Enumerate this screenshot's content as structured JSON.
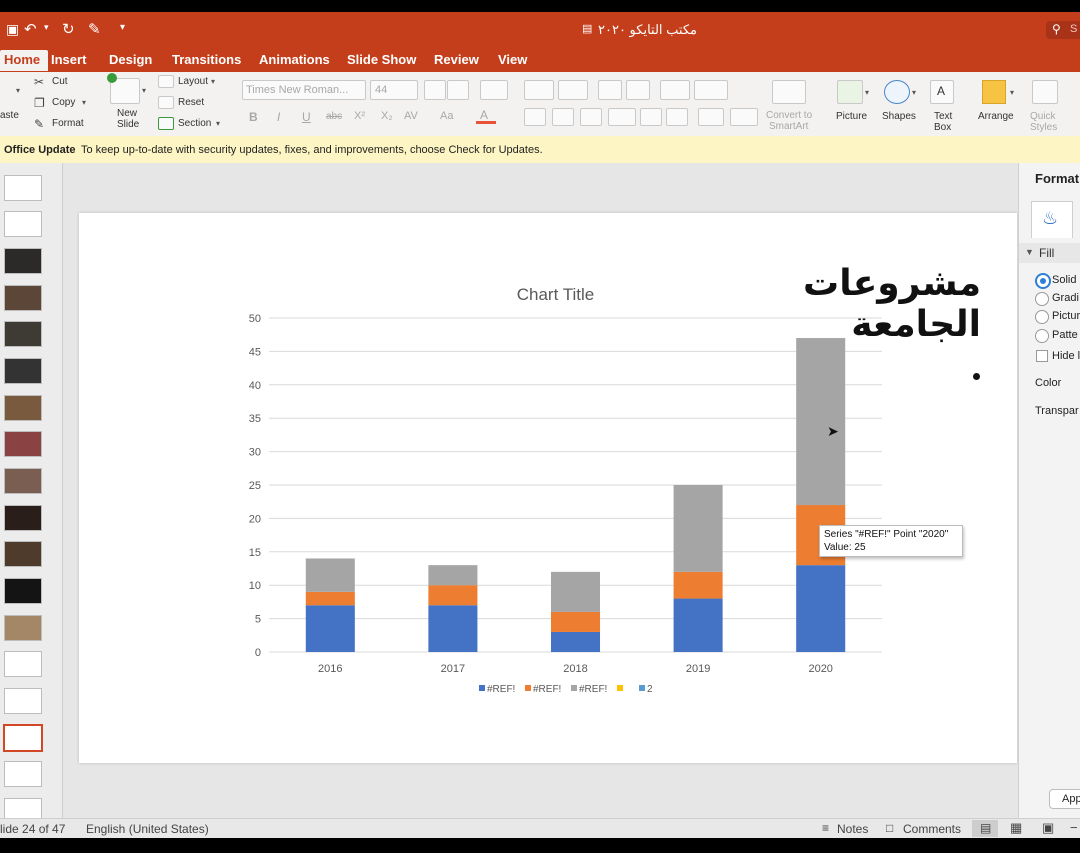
{
  "window": {
    "title": "مكتب التايكو ٢٠٢٠",
    "search_placeholder": "S"
  },
  "tabs": [
    "Home",
    "Insert",
    "Design",
    "Transitions",
    "Animations",
    "Slide Show",
    "Review",
    "View"
  ],
  "ribbon": {
    "paste": "aste",
    "cut": "Cut",
    "copy": "Copy",
    "format": "Format",
    "new_slide_line1": "New",
    "new_slide_line2": "Slide",
    "layout": "Layout",
    "reset": "Reset",
    "section": "Section",
    "font_name": "Times New Roman...",
    "font_size": "44",
    "convert_line1": "Convert to",
    "convert_line2": "SmartArt",
    "picture": "Picture",
    "shapes": "Shapes",
    "textbox_line1": "Text",
    "textbox_line2": "Box",
    "arrange": "Arrange",
    "quick_line1": "Quick",
    "quick_line2": "Styles"
  },
  "update_bar": {
    "label": "Office Update",
    "message": "To keep up-to-date with security updates, fixes, and improvements, choose Check for Updates."
  },
  "slide": {
    "heading": "مشروعات الجامعة"
  },
  "chart_data": {
    "type": "bar",
    "stacked": true,
    "title": "Chart Title",
    "categories": [
      "2016",
      "2017",
      "2018",
      "2019",
      "2020"
    ],
    "series": [
      {
        "name": "#REF!",
        "color": "#4472c4",
        "values": [
          7,
          7,
          3,
          8,
          13
        ]
      },
      {
        "name": "#REF!",
        "color": "#ed7d31",
        "values": [
          2,
          3,
          3,
          4,
          9
        ]
      },
      {
        "name": "#REF!",
        "color": "#a5a5a5",
        "values": [
          5,
          3,
          6,
          13,
          25
        ]
      }
    ],
    "extra_legend": [
      {
        "name": "",
        "color": "#ffc000"
      },
      {
        "name": "2",
        "color": "#5b9bd5"
      }
    ],
    "ylim": [
      0,
      50
    ],
    "yticks": [
      0,
      5,
      10,
      15,
      20,
      25,
      30,
      35,
      40,
      45,
      50
    ],
    "grid": true,
    "legend": "bottom"
  },
  "tooltip": {
    "line1": "Series \"#REF!\" Point \"2020\"",
    "line2": "Value: 25"
  },
  "format_pane": {
    "title": "Format",
    "section": "Fill",
    "options": [
      "Solid",
      "Gradi",
      "Pictur",
      "Patte"
    ],
    "hide": "Hide l",
    "color": "Color",
    "transparency": "Transpar",
    "apply": "App"
  },
  "status": {
    "slide": "lide 24 of 47",
    "language": "English (United States)",
    "notes": "Notes",
    "comments": "Comments"
  },
  "colors": {
    "accent": "#c43e1c",
    "selected_thumb": "#d24726"
  }
}
